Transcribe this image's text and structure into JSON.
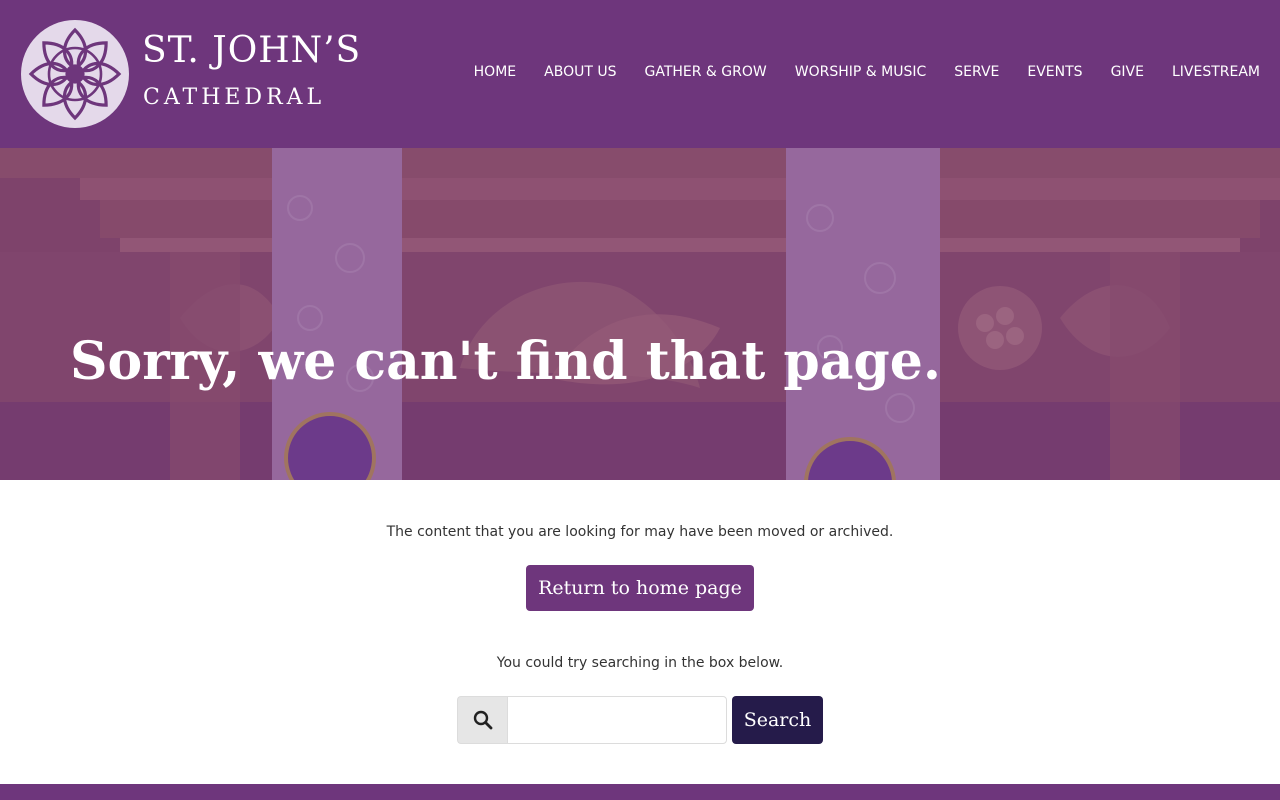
{
  "site": {
    "name_line1": "ST. JOHN’S",
    "name_line2": "CATHEDRAL",
    "logo_icon": "rose-window-icon"
  },
  "nav": {
    "items": [
      {
        "label": "HOME"
      },
      {
        "label": "ABOUT US"
      },
      {
        "label": "GATHER & GROW"
      },
      {
        "label": "WORSHIP & MUSIC"
      },
      {
        "label": "SERVE"
      },
      {
        "label": "EVENTS"
      },
      {
        "label": "GIVE"
      },
      {
        "label": "LIVESTREAM"
      }
    ]
  },
  "hero": {
    "title": "Sorry, we can't find that page."
  },
  "main": {
    "message": "The content that you are looking for may have been moved or archived.",
    "home_button": "Return to home page",
    "search_hint": "You could try searching in the box below.",
    "search_placeholder": "",
    "search_icon": "magnifier-icon",
    "search_button": "Search"
  },
  "colors": {
    "brand_purple": "#6e367c",
    "search_button": "#251b4a",
    "text": "#333333"
  }
}
